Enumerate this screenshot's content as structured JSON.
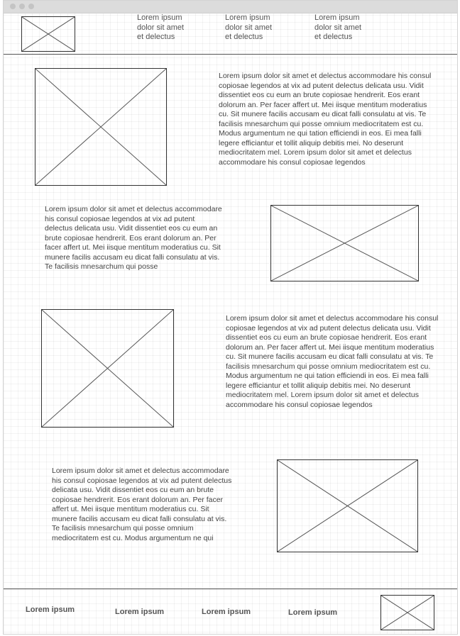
{
  "header": {
    "nav": [
      "Lorem ipsum\ndolor sit amet\net delectus",
      "Lorem ipsum\ndolor sit amet\net delectus",
      "Lorem ipsum\ndolor sit amet\net delectus"
    ]
  },
  "sections": [
    {
      "text": "Lorem ipsum dolor sit amet et delectus accommodare his consul copiosae legendos at vix ad putent delectus delicata usu. Vidit dissentiet eos cu eum an brute copiosae hendrerit. Eos erant dolorum an. Per facer affert ut. Mei iisque mentitum moderatius cu. Sit munere facilis accusam eu dicat falli consulatu at vis. Te facilisis mnesarchum qui posse omnium mediocritatem est cu. Modus argumentum ne qui tation efficiendi in eos. Ei mea falli legere efficiantur et tollit aliquip debitis mei. No deserunt mediocritatem mel. Lorem ipsum dolor sit amet et delectus accommodare his consul copiosae legendos"
    },
    {
      "text": "Lorem ipsum dolor sit amet et delectus accommodare his consul copiosae legendos at vix ad putent delectus delicata usu. Vidit dissentiet eos cu eum an brute copiosae hendrerit. Eos erant dolorum an. Per facer affert ut. Mei iisque mentitum moderatius cu. Sit munere facilis accusam eu dicat falli consulatu at vis. Te facilisis mnesarchum qui posse"
    },
    {
      "text": "Lorem ipsum dolor sit amet et delectus accommodare his consul copiosae legendos at vix ad putent delectus delicata usu. Vidit dissentiet eos cu eum an brute copiosae hendrerit. Eos erant dolorum an. Per facer affert ut. Mei iisque mentitum moderatius cu. Sit munere facilis accusam eu dicat falli consulatu at vis. Te facilisis mnesarchum qui posse omnium mediocritatem est cu. Modus argumentum ne qui tation efficiendi in eos. Ei mea falli legere efficiantur et tollit aliquip debitis mei. No deserunt mediocritatem mel. Lorem ipsum dolor sit amet et delectus accommodare his consul copiosae legendos"
    },
    {
      "text": "Lorem ipsum dolor sit amet et delectus accommodare his consul copiosae legendos at vix ad putent delectus delicata usu. Vidit dissentiet eos cu eum an brute copiosae hendrerit. Eos erant dolorum an. Per facer affert ut. Mei iisque mentitum moderatius cu. Sit munere facilis accusam eu dicat falli consulatu at vis. Te facilisis mnesarchum qui posse omnium mediocritatem est cu. Modus argumentum ne qui"
    }
  ],
  "footer": {
    "links": [
      "Lorem ipsum",
      "Lorem ipsum",
      "Lorem ipsum",
      "Lorem ipsum"
    ]
  }
}
